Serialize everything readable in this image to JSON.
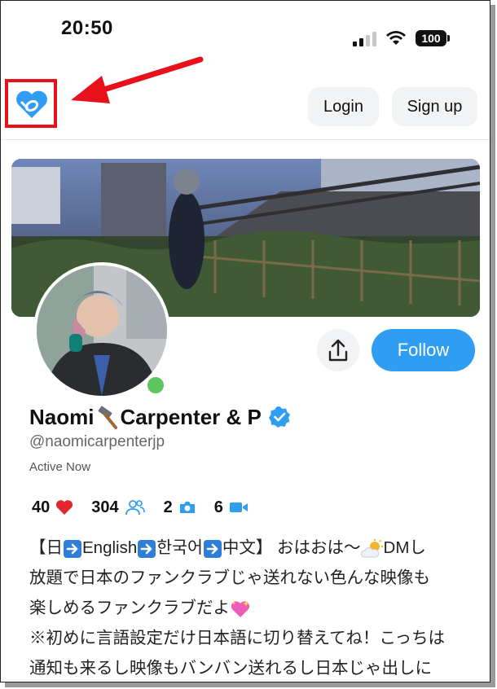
{
  "status_bar": {
    "time": "20:50",
    "battery": "100"
  },
  "header": {
    "login_label": "Login",
    "signup_label": "Sign up"
  },
  "profile": {
    "name_part1": "Naomi",
    "name_part2": "Carpenter & P",
    "handle": "@naomicarpenterjp",
    "active_status": "Active Now",
    "follow_label": "Follow",
    "stats": {
      "likes": "40",
      "followers": "304",
      "photos": "2",
      "videos": "6"
    },
    "bio": {
      "line1_a": "【日",
      "line1_b": "English",
      "line1_c": "한국어",
      "line1_d": "中文】 おはおは〜",
      "line1_e": "DMし",
      "line2": "放題で日本のファンクラブじゃ送れない色んな映像も",
      "line3": "楽しめるファンクラブだよ",
      "line4": "※初めに言語設定だけ日本語に切り替えてね！こっちは",
      "line5": "通知も来るし映像もバンバン送れるし日本じゃ出しに"
    }
  },
  "colors": {
    "accent": "#2f9df2",
    "annotation": "#e8101a",
    "online": "#5ec65e",
    "heart": "#e0262e"
  },
  "icons": [
    "logo-icon",
    "share-icon",
    "verified-icon",
    "heart-icon",
    "people-icon",
    "camera-icon",
    "video-icon",
    "hammer-icon",
    "arrow-right-icon",
    "sun-cloud-icon",
    "sparkle-heart-icon"
  ]
}
